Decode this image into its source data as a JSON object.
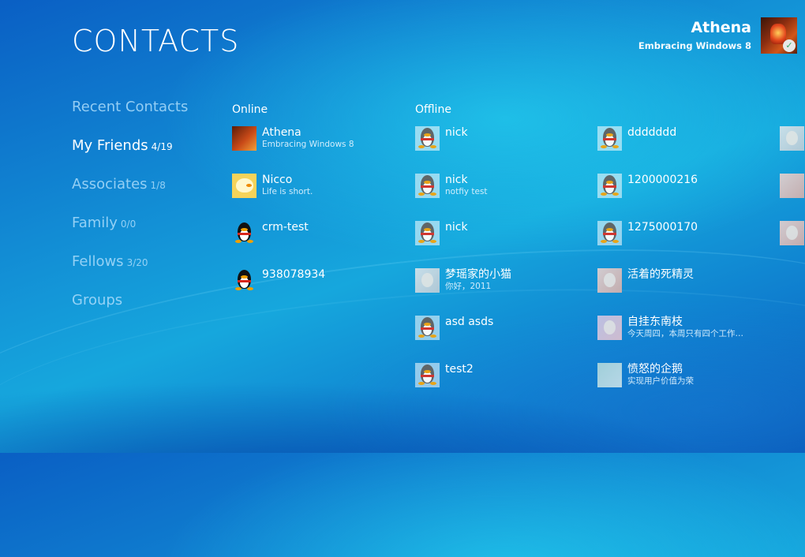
{
  "header": {
    "title": "CONTACTS",
    "user": {
      "name": "Athena",
      "status": "Embracing Windows 8"
    }
  },
  "nav": [
    {
      "label": "Recent Contacts",
      "count": ""
    },
    {
      "label": "My Friends",
      "count": "4/19"
    },
    {
      "label": "Associates",
      "count": "1/8"
    },
    {
      "label": "Family",
      "count": "0/0"
    },
    {
      "label": "Fellows",
      "count": "3/20"
    },
    {
      "label": "Groups",
      "count": ""
    }
  ],
  "active_nav": "My Friends",
  "sections": {
    "online": "Online",
    "offline": "Offline"
  },
  "online": [
    {
      "name": "Athena",
      "status": "Embracing Windows 8",
      "avatar": "lantern-photo"
    },
    {
      "name": "Nicco",
      "status": "Life is short.",
      "avatar": "duck-avatar"
    },
    {
      "name": "crm-test",
      "status": "",
      "avatar": "penguin-icon"
    },
    {
      "name": "938078934",
      "status": "",
      "avatar": "penguin-icon"
    }
  ],
  "offline_col1": [
    {
      "name": "nick",
      "status": "",
      "avatar": "penguin-icon"
    },
    {
      "name": "nick",
      "status": "notfiy test",
      "avatar": "penguin-icon"
    },
    {
      "name": "nick",
      "status": "",
      "avatar": "penguin-icon"
    },
    {
      "name": "梦瑶家的小猫",
      "status": "你好，2011",
      "avatar": "photo"
    },
    {
      "name": "asd asds",
      "status": "",
      "avatar": "penguin-icon"
    },
    {
      "name": "test2",
      "status": "",
      "avatar": "penguin-icon"
    }
  ],
  "offline_col2": [
    {
      "name": "ddddddd",
      "status": "",
      "avatar": "penguin-icon"
    },
    {
      "name": "1200000216",
      "status": "",
      "avatar": "penguin-icon"
    },
    {
      "name": "1275000170",
      "status": "",
      "avatar": "penguin-icon"
    },
    {
      "name": "活着的死精灵",
      "status": "",
      "avatar": "photo"
    },
    {
      "name": "自挂东南枝",
      "status": "今天周四，本周只有四个工作…",
      "avatar": "anime-photo"
    },
    {
      "name": "愤怒的企鹅",
      "status": "实现用户价值为荣",
      "avatar": "photo"
    }
  ],
  "colors": {
    "accent": "#1391d6",
    "nav_inactive": "#aadcfa",
    "text": "#ffffff"
  }
}
